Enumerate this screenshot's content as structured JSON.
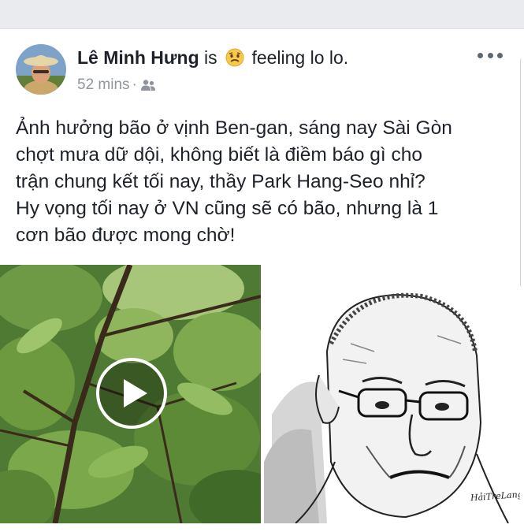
{
  "post": {
    "author": {
      "name": "Lê Minh Hưng",
      "avatar_icon": "profile-photo"
    },
    "activity": {
      "prefix": "is",
      "emoji_icon": "worried-face-icon",
      "text": "feeling lo lo."
    },
    "meta": {
      "time": "52 mins",
      "separator": "·",
      "audience_icon": "friends-icon"
    },
    "menu_icon": "more-options-icon",
    "text_lines": [
      "Ảnh hưởng bão ở vịnh Ben-gan, sáng nay Sài Gòn",
      "chợt mưa dữ dội, không biết là điềm báo gì cho",
      "trận chung kết tối nay, thầy Park Hang-Seo nhỉ?",
      "Hy vọng tối nay ở VN cũng sẽ có bão, nhưng là 1",
      "cơn bão được mong chờ!"
    ],
    "media": [
      {
        "type": "video",
        "icon": "play-icon"
      },
      {
        "type": "image",
        "signature": "HảiTreLang"
      }
    ]
  },
  "colors": {
    "text": "#1d2129",
    "meta": "#90949c",
    "background": "#ffffff",
    "separator_band": "#e9ebee"
  }
}
